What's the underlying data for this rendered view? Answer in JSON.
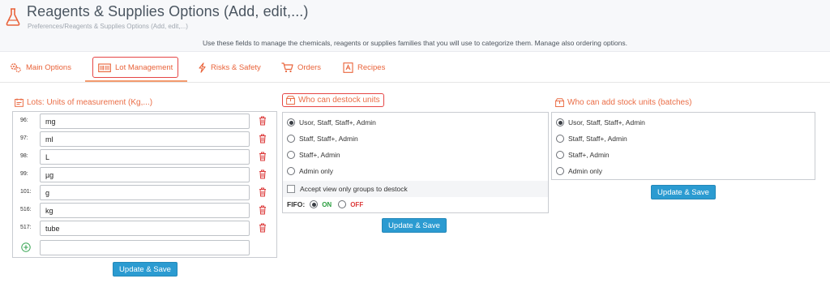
{
  "header": {
    "title": "Reagents & Supplies Options (Add, edit,...)",
    "breadcrumb": "Preferences/Reagents & Supplies Options (Add, edit,...)",
    "intro": "Use these fields to manage the chemicals, reagents or supplies families that you will use to categorize them. Manage also ordering options."
  },
  "tabs": [
    {
      "label": "Main Options",
      "icon": "gears-icon"
    },
    {
      "label": "Lot Management",
      "icon": "barcode-icon",
      "active": true
    },
    {
      "label": "Risks & Safety",
      "icon": "flash-icon"
    },
    {
      "label": "Orders",
      "icon": "cart-icon"
    },
    {
      "label": "Recipes",
      "icon": "recipe-icon"
    }
  ],
  "lots": {
    "title": "Lots: Units of measurement (Kg,...)",
    "rows": [
      {
        "id": "96:",
        "value": "mg"
      },
      {
        "id": "97:",
        "value": "ml"
      },
      {
        "id": "98:",
        "value": "L"
      },
      {
        "id": "99:",
        "value": "µg"
      },
      {
        "id": "101:",
        "value": "g"
      },
      {
        "id": "516:",
        "value": "kg"
      },
      {
        "id": "517:",
        "value": "tube"
      }
    ],
    "new_value": "",
    "save_label": "Update & Save"
  },
  "destock": {
    "title": "Who can destock units",
    "options": [
      {
        "label": "Usor, Staff, Staff+, Admin",
        "selected": true
      },
      {
        "label": "Staff, Staff+, Admin",
        "selected": false
      },
      {
        "label": "Staff+, Admin",
        "selected": false
      },
      {
        "label": "Admin only",
        "selected": false
      }
    ],
    "accept_label": "Accept view only groups to destock",
    "fifo_label": "FIFO:",
    "fifo_on": "ON",
    "fifo_off": "OFF",
    "save_label": "Update & Save"
  },
  "add_stock": {
    "title": "Who can add stock units (batches)",
    "options": [
      {
        "label": "Usor, Staff, Staff+, Admin",
        "selected": true
      },
      {
        "label": "Staff, Staff+, Admin",
        "selected": false
      },
      {
        "label": "Staff+, Admin",
        "selected": false
      },
      {
        "label": "Admin only",
        "selected": false
      }
    ],
    "save_label": "Update & Save"
  },
  "colors": {
    "accent": "#ea6d46",
    "highlight": "#e54646",
    "button": "#2b9bd1",
    "on": "#2a9e3f",
    "off": "#dc3b3b"
  }
}
